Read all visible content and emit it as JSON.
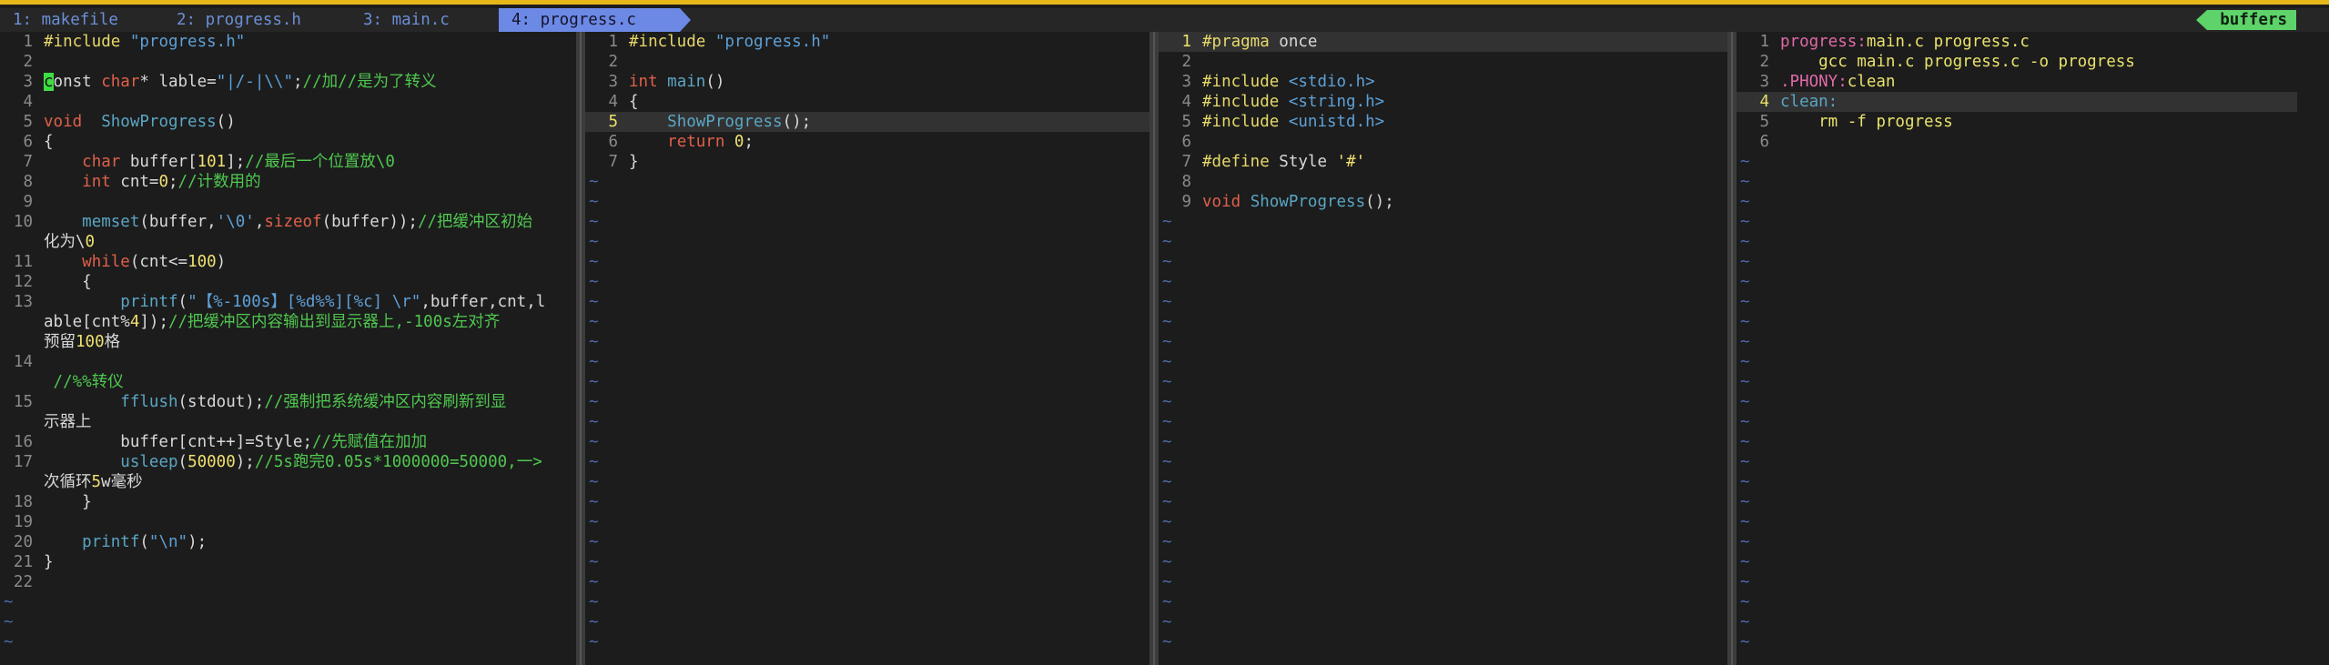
{
  "tabs": [
    {
      "label": "1: makefile",
      "active": false
    },
    {
      "label": "2: progress.h",
      "active": false
    },
    {
      "label": "3: main.c",
      "active": false
    },
    {
      "label": "4: progress.c",
      "active": true
    }
  ],
  "buffers_label": "buffers",
  "colors": {
    "keyword": "#e0604a",
    "type": "#d9736a",
    "func": "#5aa6c4",
    "string": "#5ea0d6",
    "comment": "#4fc84f",
    "number": "#f0e070",
    "preproc": "#e6d86a",
    "make_target": "#e06aa8",
    "make_cmd": "#e9e26b"
  },
  "panes": [
    {
      "id": "progress_c",
      "lines": [
        {
          "n": "1",
          "text": "#include \"progress.h\""
        },
        {
          "n": "2",
          "text": ""
        },
        {
          "n": "3",
          "text": "const char* lable=\"|/-|\\\\\";//加//是为了转义",
          "cursor": true
        },
        {
          "n": "4",
          "text": ""
        },
        {
          "n": "5",
          "text": "void  ShowProgress()"
        },
        {
          "n": "6",
          "text": "{"
        },
        {
          "n": "7",
          "text": "    char buffer[101];//最后一个位置放\\0"
        },
        {
          "n": "8",
          "text": "    int cnt=0;//计数用的"
        },
        {
          "n": "9",
          "text": ""
        },
        {
          "n": "10",
          "text": "    memset(buffer,'\\0',sizeof(buffer));//把缓冲区初始"
        },
        {
          "n": "",
          "text": "化为\\0"
        },
        {
          "n": "11",
          "text": "    while(cnt<=100)"
        },
        {
          "n": "12",
          "text": "    {"
        },
        {
          "n": "13",
          "text": "        printf(\"【%-100s】[%d%%][%c] \\r\",buffer,cnt,l"
        },
        {
          "n": "",
          "text": "able[cnt%4]);//把缓冲区内容输出到显示器上,-100s左对齐"
        },
        {
          "n": "",
          "text": "预留100格"
        },
        {
          "n": "14",
          "text": ""
        },
        {
          "n": "",
          "text": " //%%转仪"
        },
        {
          "n": "15",
          "text": "        fflush(stdout);//强制把系统缓冲区内容刷新到显"
        },
        {
          "n": "",
          "text": "示器上"
        },
        {
          "n": "16",
          "text": "        buffer[cnt++]=Style;//先赋值在加加"
        },
        {
          "n": "17",
          "text": "        usleep(50000);//5s跑完0.05s*1000000=50000,一>"
        },
        {
          "n": "",
          "text": "次循环5w毫秒"
        },
        {
          "n": "18",
          "text": "    }"
        },
        {
          "n": "19",
          "text": ""
        },
        {
          "n": "20",
          "text": "    printf(\"\\n\");"
        },
        {
          "n": "21",
          "text": "}"
        },
        {
          "n": "22",
          "text": ""
        }
      ]
    },
    {
      "id": "main_c",
      "lines": [
        {
          "n": "1",
          "text": "#include \"progress.h\""
        },
        {
          "n": "2",
          "text": ""
        },
        {
          "n": "3",
          "text": "int main()"
        },
        {
          "n": "4",
          "text": "{"
        },
        {
          "n": "5",
          "text": "    ShowProgress();",
          "current": true
        },
        {
          "n": "6",
          "text": "    return 0;"
        },
        {
          "n": "7",
          "text": "}"
        }
      ]
    },
    {
      "id": "progress_h",
      "lines": [
        {
          "n": "1",
          "text": "#pragma once",
          "current": true
        },
        {
          "n": "2",
          "text": ""
        },
        {
          "n": "3",
          "text": "#include <stdio.h>"
        },
        {
          "n": "4",
          "text": "#include <string.h>"
        },
        {
          "n": "5",
          "text": "#include <unistd.h>"
        },
        {
          "n": "6",
          "text": ""
        },
        {
          "n": "7",
          "text": "#define Style '#'"
        },
        {
          "n": "8",
          "text": ""
        },
        {
          "n": "9",
          "text": "void ShowProgress();"
        }
      ]
    },
    {
      "id": "makefile",
      "lines": [
        {
          "n": "1",
          "text": "progress:main.c progress.c"
        },
        {
          "n": "2",
          "text": "    gcc main.c progress.c -o progress"
        },
        {
          "n": "3",
          "text": ".PHONY:clean"
        },
        {
          "n": "4",
          "text": "clean:",
          "current": true
        },
        {
          "n": "5",
          "text": "    rm -f progress"
        },
        {
          "n": "6",
          "text": ""
        }
      ]
    }
  ]
}
